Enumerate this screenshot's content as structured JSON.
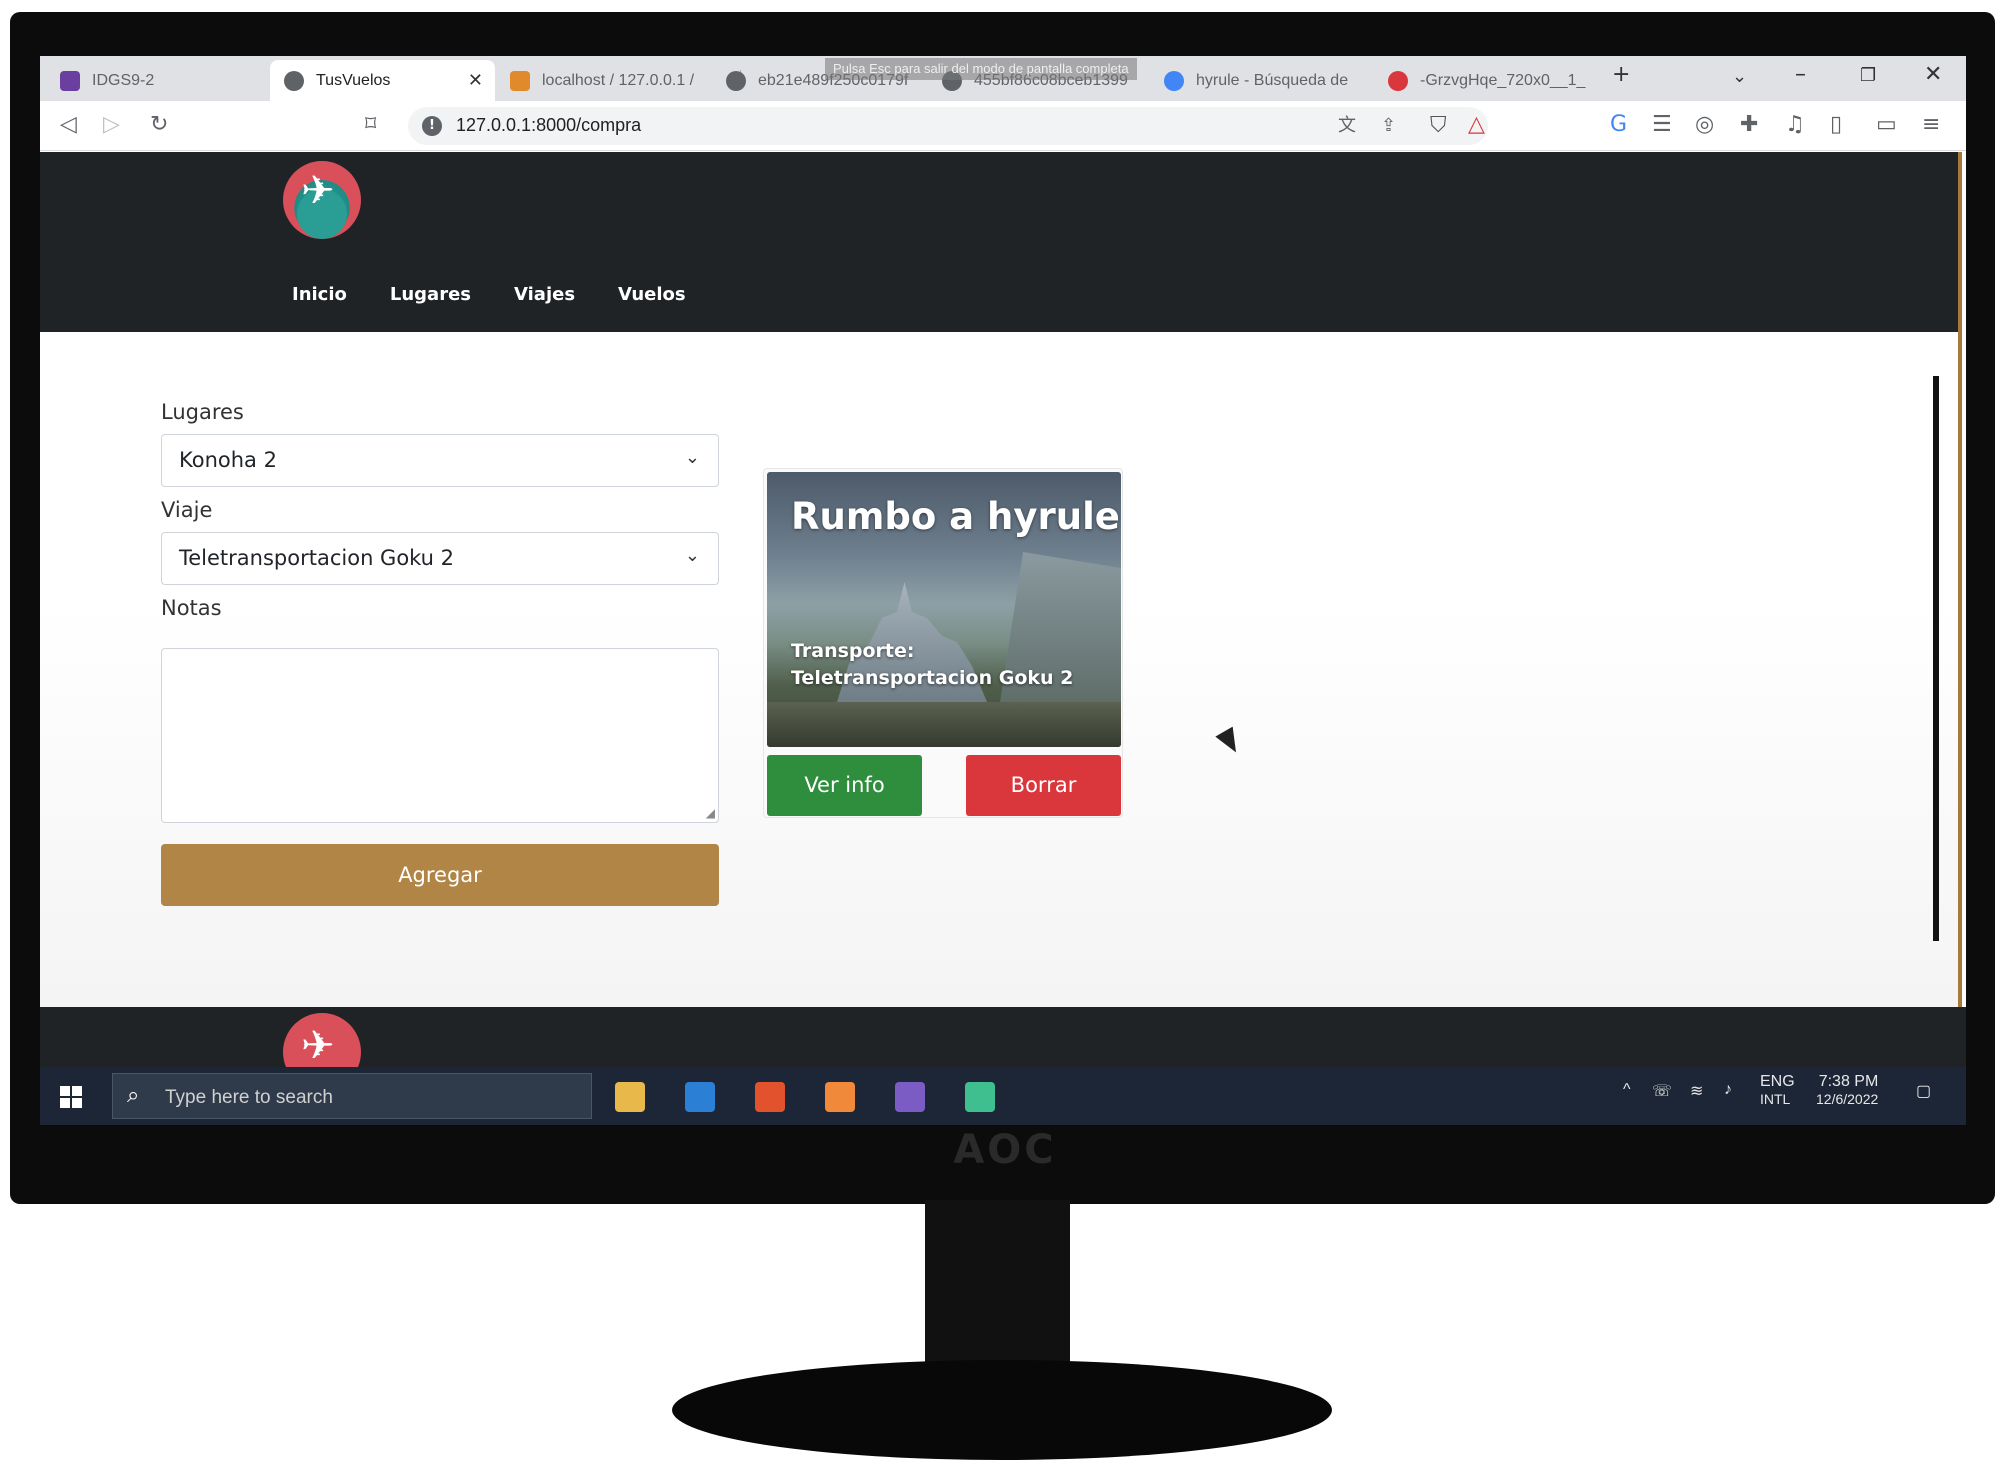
{
  "browser": {
    "tabs": [
      {
        "label": "IDGS9-2",
        "active": false
      },
      {
        "label": "TusVuelos",
        "active": true
      },
      {
        "label": "localhost / 127.0.0.1 /",
        "active": false
      },
      {
        "label": "eb21e489f250c0179f",
        "active": false
      },
      {
        "label": "455bf86c08bceb1399",
        "active": false
      },
      {
        "label": "hyrule - Búsqueda de",
        "active": false
      },
      {
        "label": "-GrzvgHqe_720x0__1_",
        "active": false
      }
    ],
    "fullscreen_hint": "Pulsa  Esc  para salir del modo de pantalla completa",
    "url": "127.0.0.1:8000/compra"
  },
  "site": {
    "nav": [
      "Inicio",
      "Lugares",
      "Viajes",
      "Vuelos"
    ]
  },
  "form": {
    "lugares_label": "Lugares",
    "lugares_value": "Konoha 2",
    "viaje_label": "Viaje",
    "viaje_value": "Teletransportacion Goku 2",
    "notas_label": "Notas",
    "notas_value": "",
    "submit_label": "Agregar"
  },
  "card": {
    "title": "Rumbo a hyrule",
    "text_line1": "Transporte:",
    "text_line2": "Teletransportacion Goku 2",
    "info_label": "Ver info",
    "delete_label": "Borrar"
  },
  "taskbar": {
    "search_placeholder": "Type here to search",
    "lang": "ENG",
    "lang_sub": "INTL",
    "time": "7:38 PM",
    "date": "12/6/2022"
  },
  "monitor": {
    "brand": "AOC"
  },
  "colors": {
    "header_bg": "#1f2326",
    "agregar": "#b08546",
    "ver_info": "#2f8e3e",
    "borrar": "#d9373b"
  }
}
